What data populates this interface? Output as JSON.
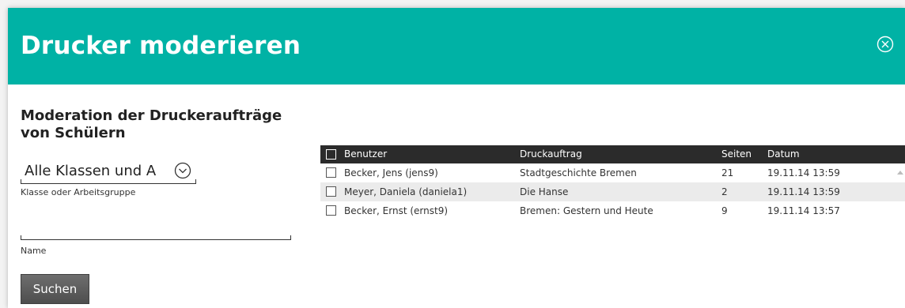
{
  "header": {
    "title": "Drucker moderieren",
    "close_icon": "close-circle-x-icon",
    "color": "#00b2a5"
  },
  "filter": {
    "heading": "Moderation der Druckeraufträge von Schülern",
    "class_select": {
      "value": "Alle Klassen und A",
      "icon": "chevron-down-circle-icon",
      "label": "Klasse oder Arbeitsgruppe"
    },
    "name_field": {
      "value": "",
      "label": "Name"
    },
    "search_button": "Suchen"
  },
  "table": {
    "columns": [
      "Benutzer",
      "Druckauftrag",
      "Seiten",
      "Datum"
    ],
    "rows": [
      {
        "user": "Becker, Jens (jens9)",
        "job": "Stadtgeschichte Bremen",
        "pages": "21",
        "date": "19.11.14 13:59"
      },
      {
        "user": "Meyer, Daniela (daniela1)",
        "job": "Die Hanse",
        "pages": "2",
        "date": "19.11.14 13:59"
      },
      {
        "user": "Becker, Ernst (ernst9)",
        "job": "Bremen: Gestern und Heute",
        "pages": "9",
        "date": "19.11.14 13:57"
      }
    ]
  }
}
